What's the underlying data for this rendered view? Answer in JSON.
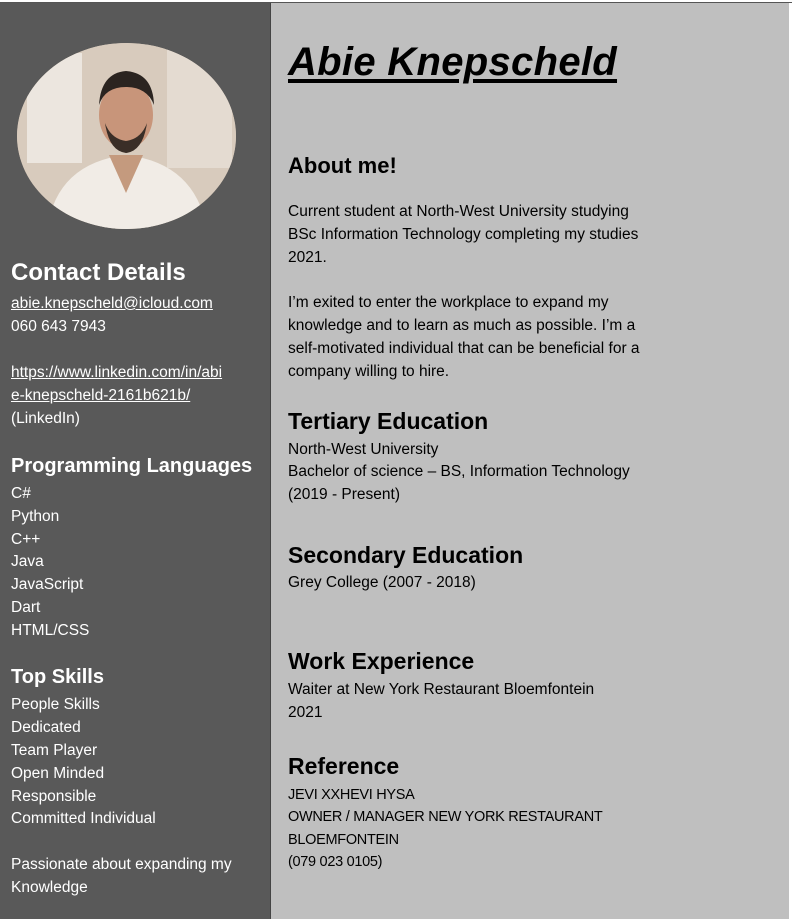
{
  "name": "Abie Knepscheld",
  "contact": {
    "heading": "Contact Details",
    "email": "abie.knepscheld@icloud.com",
    "phone": "060 643 7943",
    "linkedin_line1": "https://www.linkedin.com/in/abi",
    "linkedin_line2": "e-knepscheld-2161b621b/",
    "linkedin_note": "(LinkedIn)"
  },
  "languages": {
    "heading": "Programming Languages",
    "items": [
      "C#",
      "Python",
      "C++",
      "Java",
      "JavaScript",
      "Dart",
      "HTML/CSS"
    ]
  },
  "skills": {
    "heading": "Top Skills",
    "items": [
      "People Skills",
      "Dedicated",
      "Team Player",
      "Open Minded",
      "Responsible",
      "Committed Individual"
    ],
    "passion_line1": "Passionate about expanding my",
    "passion_line2": "Knowledge"
  },
  "about": {
    "heading": "About me!",
    "p1": [
      "Current student at North-West University studying",
      "BSc Information Technology completing my studies",
      "2021."
    ],
    "p2": [
      "I’m exited to enter the workplace to expand my",
      "knowledge and to learn as much as possible. I’m a",
      "self-motivated individual that can be beneficial for a",
      "company willing to hire."
    ]
  },
  "tertiary": {
    "heading": "Tertiary Education",
    "lines": [
      "North-West University",
      "Bachelor of science – BS, Information Technology",
      "(2019 - Present)"
    ]
  },
  "secondary": {
    "heading": "Secondary Education",
    "lines": [
      "Grey College (2007 - 2018)"
    ]
  },
  "work": {
    "heading": "Work Experience",
    "lines": [
      "Waiter at New York Restaurant Bloemfontein",
      "2021"
    ]
  },
  "reference": {
    "heading": "Reference",
    "lines": [
      "JEVI XXHEVI HYSA",
      "OWNER / MANAGER NEW YORK RESTAURANT",
      "BLOEMFONTEIN",
      "(079 023 0105)"
    ]
  }
}
